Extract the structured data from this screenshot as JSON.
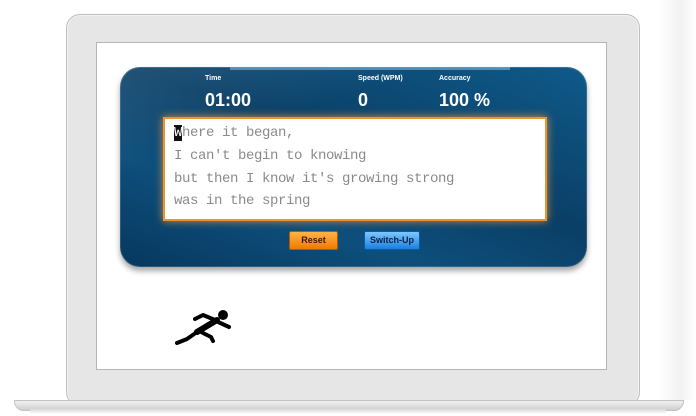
{
  "stats": {
    "time_label": "Time",
    "time_value": "01:00",
    "speed_label": "Speed (WPM)",
    "speed_value": "0",
    "accuracy_label": "Accuracy",
    "accuracy_value": "100 %"
  },
  "typing_text": {
    "cursor_char": "W",
    "line1_rest": "here it began,",
    "line2": "I can't begin to knowing",
    "line3": "but then I know it's growing strong",
    "line4": "was in the spring"
  },
  "buttons": {
    "reset_label": "Reset",
    "switch_label": "Switch-Up"
  },
  "colors": {
    "panel": "#0a3f66",
    "textbox_border": "#f0922e",
    "reset": "#f07a00",
    "switch": "#1a7fe0"
  }
}
